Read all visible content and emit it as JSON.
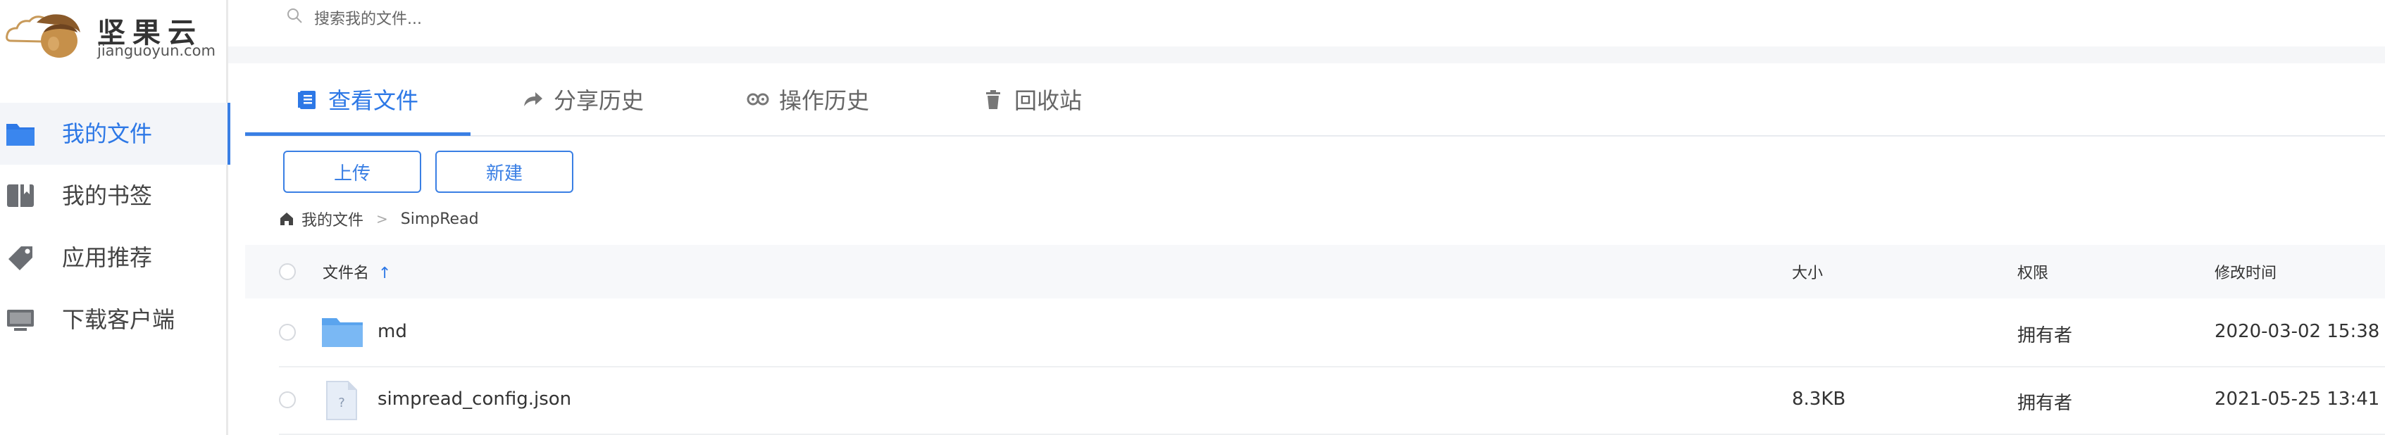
{
  "brand": {
    "name_cn": "坚果云",
    "domain": "jianguoyun.com"
  },
  "search": {
    "placeholder": "搜索我的文件..."
  },
  "sidebar": {
    "items": [
      {
        "label": "我的文件",
        "icon": "folder-icon",
        "active": true
      },
      {
        "label": "我的书签",
        "icon": "bookmark-icon",
        "active": false
      },
      {
        "label": "应用推荐",
        "icon": "tag-icon",
        "active": false
      },
      {
        "label": "下载客户端",
        "icon": "monitor-icon",
        "active": false
      }
    ]
  },
  "tabs": [
    {
      "label": "查看文件",
      "icon": "document-icon",
      "active": true
    },
    {
      "label": "分享历史",
      "icon": "share-arrow-icon",
      "active": false
    },
    {
      "label": "操作历史",
      "icon": "history-icon",
      "active": false
    },
    {
      "label": "回收站",
      "icon": "trash-icon",
      "active": false
    }
  ],
  "toolbar": {
    "upload_label": "上传",
    "new_label": "新建"
  },
  "breadcrumb": {
    "root": "我的文件",
    "separator": ">",
    "current": "SimpRead"
  },
  "table": {
    "headers": {
      "name": "文件名",
      "sort_indicator": "↑",
      "size": "大小",
      "permission": "权限",
      "modified": "修改时间"
    },
    "rows": [
      {
        "name": "md",
        "type": "folder",
        "size": "",
        "permission": "拥有者",
        "modified": "2020-03-02 15:38"
      },
      {
        "name": "simpread_config.json",
        "type": "unknown-file",
        "size": "8.3KB",
        "permission": "拥有者",
        "modified": "2021-05-25 13:41"
      }
    ]
  },
  "colors": {
    "accent": "#3a7fe4",
    "active_text": "#2d78e6",
    "folder": "#6aaef0"
  }
}
